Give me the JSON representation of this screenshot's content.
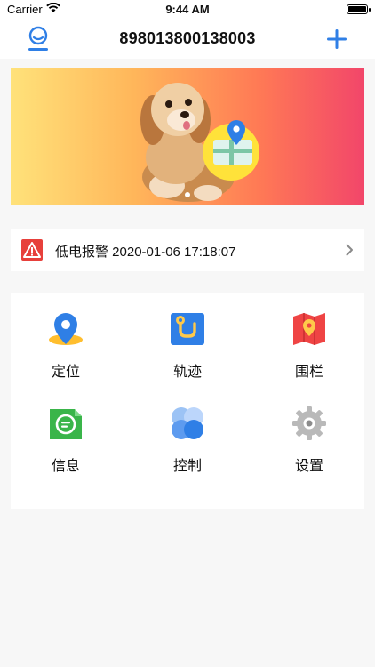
{
  "status": {
    "carrier": "Carrier",
    "time": "9:44 AM"
  },
  "header": {
    "title": "898013800138003",
    "left_icon": "user-icon",
    "right_icon": "plus-icon"
  },
  "banner": {
    "dots": 1
  },
  "alert": {
    "text": "低电报警 2020-01-06 17:18:07",
    "icon": "warning-icon",
    "accent": "#e7403b"
  },
  "features": [
    {
      "label": "定位",
      "icon": "location-pin-icon"
    },
    {
      "label": "轨迹",
      "icon": "track-icon"
    },
    {
      "label": "围栏",
      "icon": "fence-map-icon"
    },
    {
      "label": "信息",
      "icon": "message-icon"
    },
    {
      "label": "控制",
      "icon": "control-icon"
    },
    {
      "label": "设置",
      "icon": "gear-icon"
    }
  ],
  "colors": {
    "accent": "#2f7fe6",
    "alert": "#e7403b"
  }
}
